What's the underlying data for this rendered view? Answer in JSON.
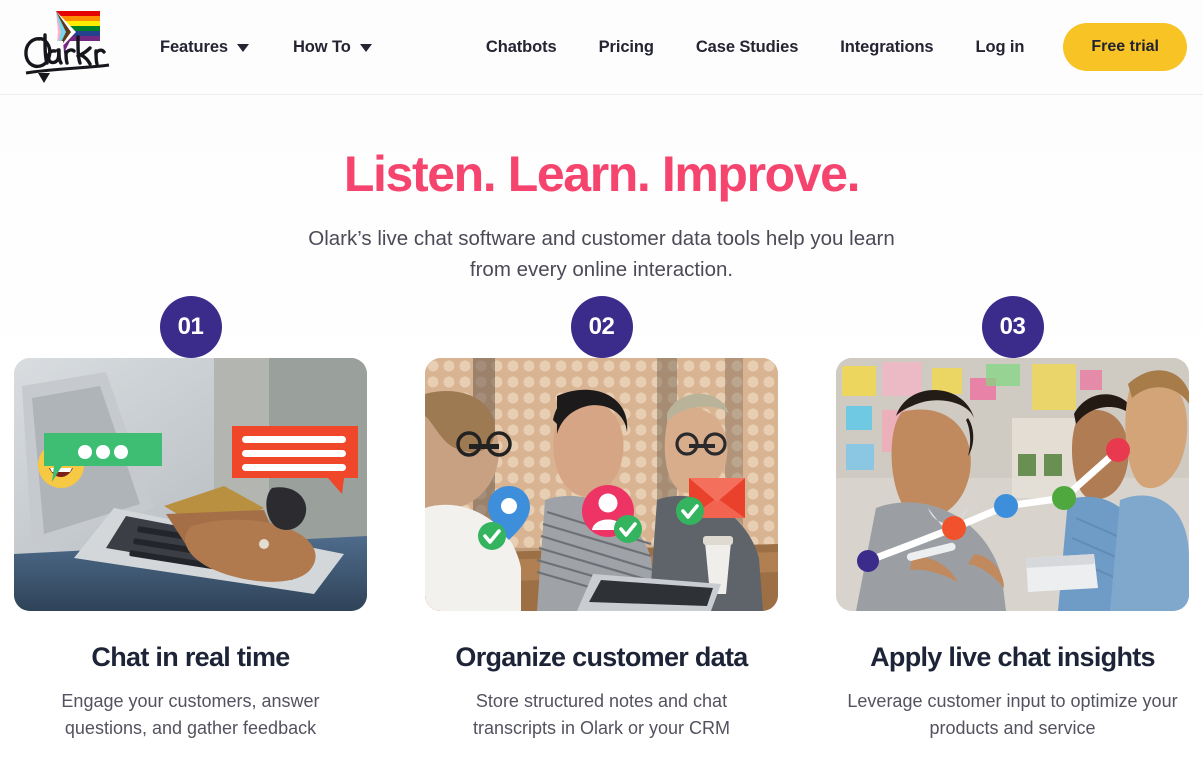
{
  "brand": {
    "logo_text": "Olark",
    "logo_name": "olark-logo",
    "flag_icon": "progress-pride-flag-chat-bubble"
  },
  "colors": {
    "accent_pink": "#F5456E",
    "cta_yellow": "#F7C325",
    "badge_purple": "#3B2C8C",
    "nav_text": "#242433",
    "heading_navy": "#1e2437",
    "body_gray": "#53535f"
  },
  "nav": {
    "left_items": [
      {
        "label": "Features",
        "has_caret": true,
        "icon": "chevron-down-icon"
      },
      {
        "label": "How To",
        "has_caret": true,
        "icon": "chevron-down-icon"
      }
    ],
    "right_items": [
      {
        "label": "Chatbots"
      },
      {
        "label": "Pricing"
      },
      {
        "label": "Case Studies"
      },
      {
        "label": "Integrations"
      },
      {
        "label": "Log in"
      }
    ],
    "cta_label": "Free trial"
  },
  "hero": {
    "heading": "Listen. Learn. Improve.",
    "subheading": "Olark’s live chat software and customer data tools help you learn from every online interaction."
  },
  "cards": [
    {
      "badge": "01",
      "title": "Chat in real time",
      "description": "Engage your customers, answer questions, and gather feedback",
      "image_name": "person-on-laptop-with-credit-card",
      "overlays": [
        "smiley-emoji-icon",
        "green-chat-bubble-icon",
        "red-message-bubble-icon"
      ]
    },
    {
      "badge": "02",
      "title": "Organize customer data",
      "description": "Store structured notes and chat transcripts in Olark or your CRM",
      "image_name": "team-at-table-with-laptop",
      "overlays": [
        "blue-location-pin-icon",
        "pink-person-avatar-icon",
        "red-envelope-icon",
        "green-check-badge-icon"
      ]
    },
    {
      "badge": "03",
      "title": "Apply live chat insights",
      "description": "Leverage customer input to optimize your products and service",
      "image_name": "team-discussion-with-notes",
      "overlays": [
        "line-chart-overlay-icon"
      ]
    }
  ]
}
